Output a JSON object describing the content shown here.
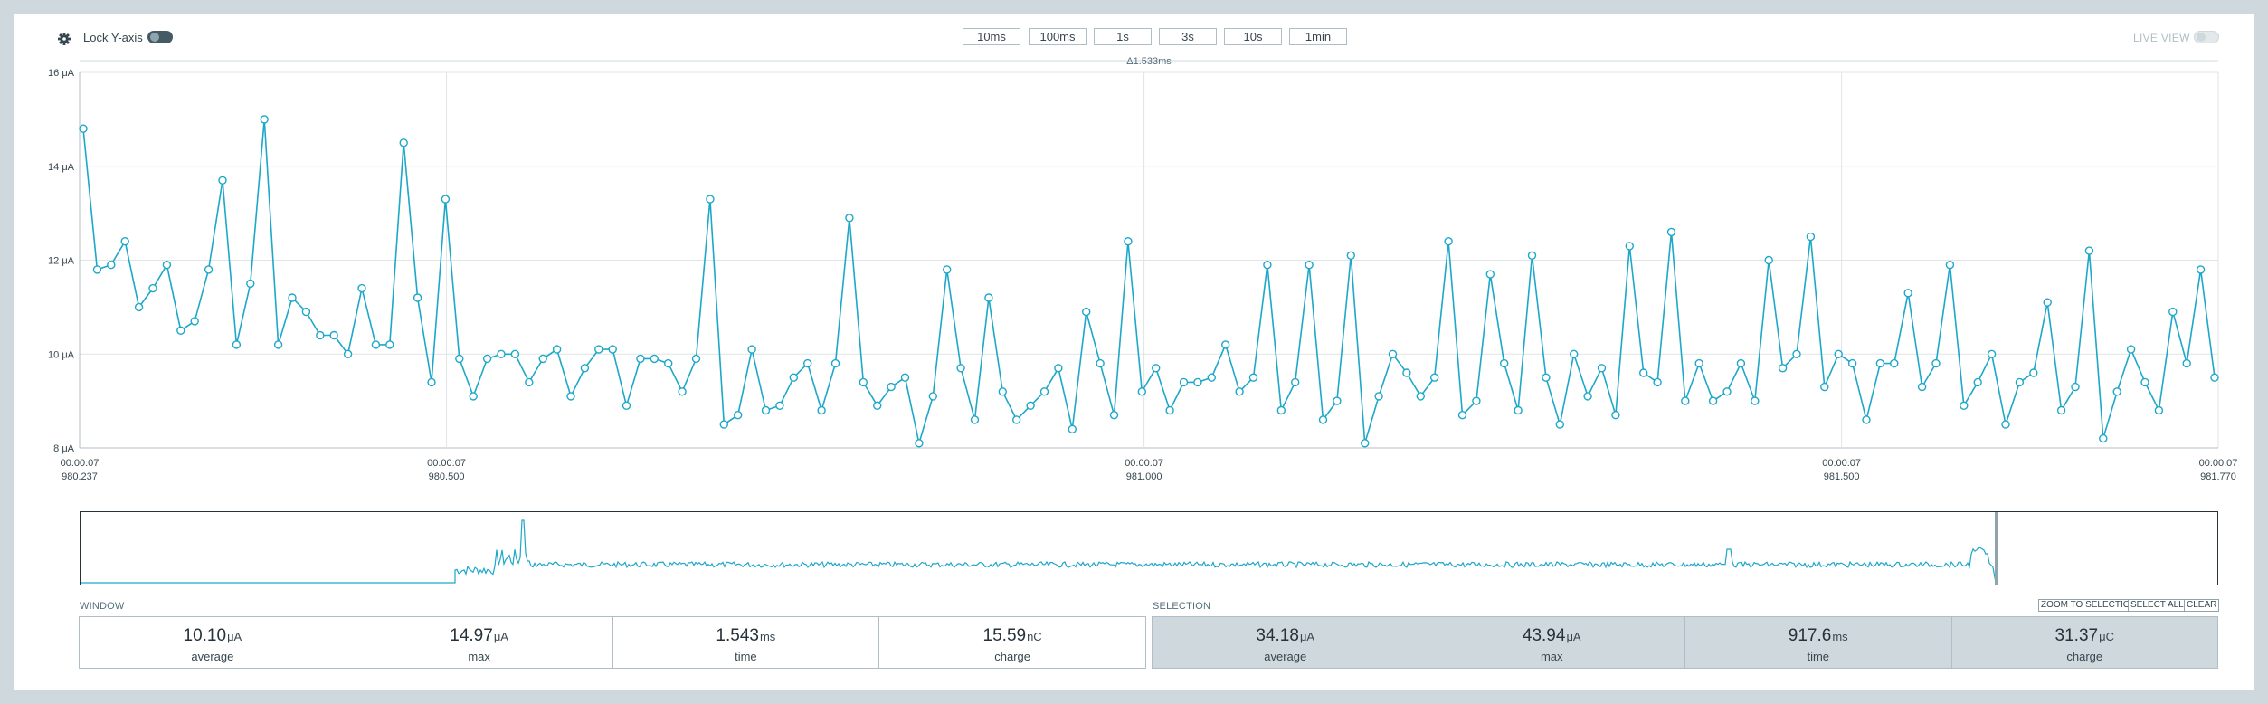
{
  "toolbar": {
    "lock_label": "Lock Y-axis",
    "live_label": "LIVE VIEW",
    "window_buttons": [
      "10ms",
      "100ms",
      "1s",
      "3s",
      "10s",
      "1min"
    ]
  },
  "colors": {
    "trace": "#1da7c9",
    "grid": "#e0e4e6",
    "selection_box": "#cfd8dc"
  },
  "chart_data": {
    "type": "line",
    "delta_label": "Δ1.533ms",
    "y_unit": "μA",
    "ylim": [
      8,
      16
    ],
    "y_ticks": [
      "8 μA",
      "10 μA",
      "12 μA",
      "14 μA",
      "16 μA"
    ],
    "x_ticks": [
      {
        "time": "00:00:07",
        "ms": "980.237"
      },
      {
        "time": "00:00:07",
        "ms": "980.500"
      },
      {
        "time": "00:00:07",
        "ms": "981.000"
      },
      {
        "time": "00:00:07",
        "ms": "981.500"
      },
      {
        "time": "00:00:07",
        "ms": "981.770"
      }
    ],
    "grid": true,
    "series": [
      {
        "values": [
          14.8,
          11.8,
          11.9,
          12.4,
          11.0,
          11.4,
          11.9,
          10.5,
          10.7,
          11.8,
          13.7,
          10.2,
          11.5,
          15.0,
          10.2,
          11.2,
          10.9,
          10.4,
          10.4,
          10.0,
          11.4,
          10.2,
          10.2,
          14.5,
          11.2,
          9.4,
          13.3,
          9.9,
          9.1,
          9.9,
          10.0,
          10.0,
          9.4,
          9.9,
          10.1,
          9.1,
          9.7,
          10.1,
          10.1,
          8.9,
          9.9,
          9.9,
          9.8,
          9.2,
          9.9,
          13.3,
          8.5,
          8.7,
          10.1,
          8.8,
          8.9,
          9.5,
          9.8,
          8.8,
          9.8,
          12.9,
          9.4,
          8.9,
          9.3,
          9.5,
          8.1,
          9.1,
          11.8,
          9.7,
          8.6,
          11.2,
          9.2,
          8.6,
          8.9,
          9.2,
          9.7,
          8.4,
          10.9,
          9.8,
          8.7,
          12.4,
          9.2,
          9.7,
          8.8,
          9.4,
          9.4,
          9.5,
          10.2,
          9.2,
          9.5,
          11.9,
          8.8,
          9.4,
          11.9,
          8.6,
          9.0,
          12.1,
          8.1,
          9.1,
          10.0,
          9.6,
          9.1,
          9.5,
          12.4,
          8.7,
          9.0,
          11.7,
          9.8,
          8.8,
          12.1,
          9.5,
          8.5,
          10.0,
          9.1,
          9.7,
          8.7,
          12.3,
          9.6,
          9.4,
          12.6,
          9.0,
          9.8,
          9.0,
          9.2,
          9.8,
          9.0,
          12.0,
          9.7,
          10.0,
          12.5,
          9.3,
          10.0,
          9.8,
          8.6,
          9.8,
          9.8,
          11.3,
          9.3,
          9.8,
          11.9,
          8.9,
          9.4,
          10.0,
          8.5,
          9.4,
          9.6,
          11.1,
          8.8,
          9.3,
          12.2,
          8.2,
          9.2,
          10.1,
          9.4,
          8.8,
          10.9,
          9.8,
          11.8,
          9.5
        ]
      }
    ]
  },
  "overview": {
    "label": "overview-trace"
  },
  "window_stats": {
    "label": "WINDOW",
    "items": [
      {
        "value": "10.10",
        "unit": "μA",
        "caption": "average"
      },
      {
        "value": "14.97",
        "unit": "μA",
        "caption": "max"
      },
      {
        "value": "1.543",
        "unit": "ms",
        "caption": "time"
      },
      {
        "value": "15.59",
        "unit": "nC",
        "caption": "charge"
      }
    ]
  },
  "selection_stats": {
    "label": "SELECTION",
    "buttons": [
      "ZOOM TO SELECTION",
      "SELECT ALL",
      "CLEAR"
    ],
    "items": [
      {
        "value": "34.18",
        "unit": "μA",
        "caption": "average"
      },
      {
        "value": "43.94",
        "unit": "μA",
        "caption": "max"
      },
      {
        "value": "917.6",
        "unit": "ms",
        "caption": "time"
      },
      {
        "value": "31.37",
        "unit": "μC",
        "caption": "charge"
      }
    ]
  }
}
